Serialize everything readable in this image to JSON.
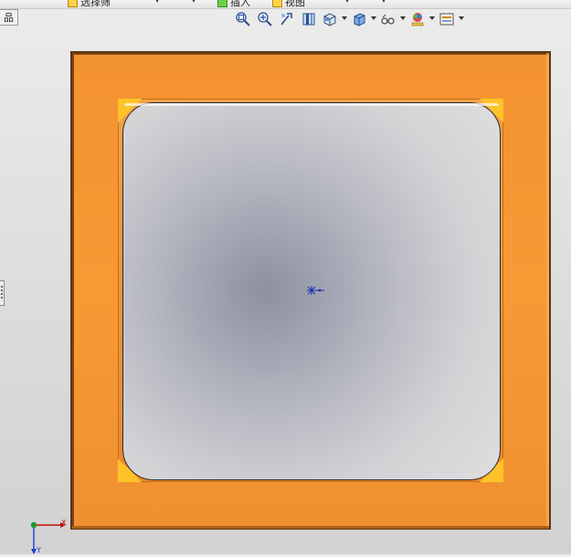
{
  "top_menu": {
    "items": [
      {
        "label": "选择筛",
        "icon": "filter-icon"
      },
      {
        "label": "插入",
        "icon": "insert-icon"
      },
      {
        "label": "视图",
        "icon": "view-icon"
      }
    ]
  },
  "left_panel": {
    "tab_label": "品"
  },
  "view_toolbar": {
    "buttons": [
      {
        "name": "zoom-to-fit-icon"
      },
      {
        "name": "zoom-to-area-icon"
      },
      {
        "name": "previous-view-icon"
      },
      {
        "name": "section-view-icon"
      },
      {
        "name": "view-orientation-icon",
        "has_dropdown": true
      },
      {
        "name": "display-style-icon",
        "has_dropdown": true
      },
      {
        "name": "hide-show-items-icon",
        "has_dropdown": true
      },
      {
        "name": "edit-appearance-icon",
        "has_dropdown": true
      },
      {
        "name": "apply-scene-icon",
        "has_dropdown": true
      }
    ]
  },
  "model": {
    "frame_color": "#f7952f",
    "corner_highlight_color": "#ffc32a",
    "background_center_color": "#8c90a0",
    "background_edge_color": "#dededf"
  },
  "triad": {
    "x_label": "X",
    "y_label": "Y",
    "x_color": "#c21010",
    "y_color": "#1a3fd0",
    "z_color": "#1f9a2a"
  }
}
